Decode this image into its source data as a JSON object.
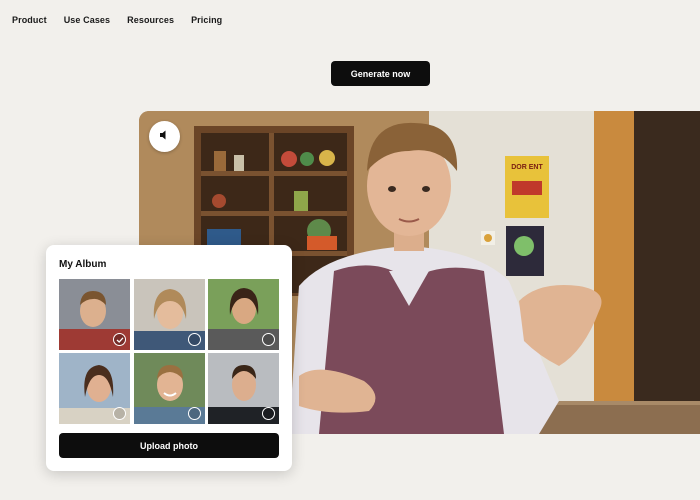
{
  "nav": {
    "items": [
      {
        "label": "Product"
      },
      {
        "label": "Use Cases"
      },
      {
        "label": "Resources"
      },
      {
        "label": "Pricing"
      }
    ]
  },
  "hero": {
    "cta_label": "Generate now"
  },
  "video": {
    "mute_icon": "speaker-muted-icon",
    "poster_text": "DOR ENT"
  },
  "album": {
    "title": "My Album",
    "photos": [
      {
        "selected": true
      },
      {
        "selected": false
      },
      {
        "selected": false
      },
      {
        "selected": false
      },
      {
        "selected": false
      },
      {
        "selected": false
      }
    ],
    "upload_label": "Upload photo"
  },
  "colors": {
    "background": "#f2f0ec",
    "button": "#0d0d0d",
    "card": "#ffffff"
  }
}
